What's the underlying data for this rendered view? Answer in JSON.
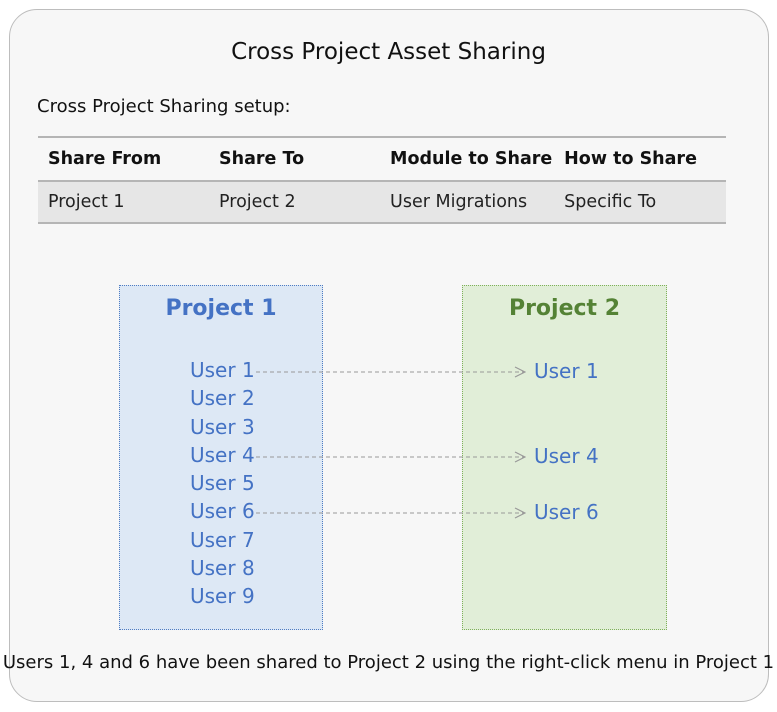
{
  "title": "Cross Project Asset Sharing",
  "setup_label": "Cross Project Sharing setup:",
  "table": {
    "headers": [
      "Share From",
      "Share To",
      "Module to Share",
      "How to Share"
    ],
    "rows": [
      [
        "Project 1",
        "Project 2",
        "User Migrations",
        "Specific To"
      ]
    ]
  },
  "project1": {
    "title": "Project 1",
    "users": [
      "User 1",
      "User 2",
      "User 3",
      "User 4",
      "User 5",
      "User 6",
      "User 7",
      "User 8",
      "User 9"
    ]
  },
  "project2": {
    "title": "Project 2",
    "users": [
      "User 1",
      "User 4",
      "User 6"
    ]
  },
  "footer": "Users 1, 4 and 6 have been shared to Project 2 using the right-click menu in Project 1",
  "colors": {
    "project1_fill": "#dde8f5",
    "project1_accent": "#4472c4",
    "project2_fill": "#e1eed8",
    "project2_accent": "#548235",
    "arrow": "#999999"
  }
}
